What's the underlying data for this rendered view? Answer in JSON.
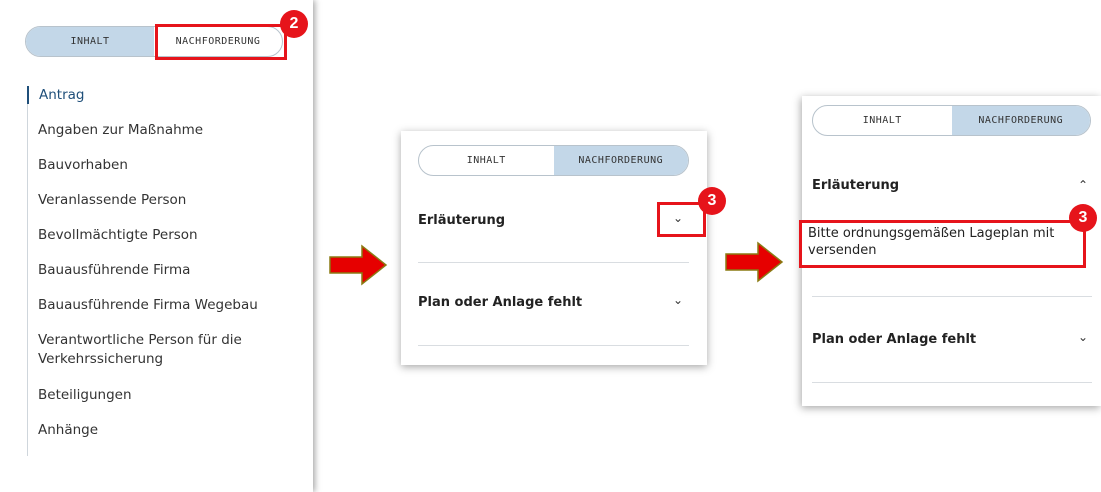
{
  "toggle": {
    "content_label": "INHALT",
    "requests_label": "NACHFORDERUNG"
  },
  "nav": {
    "items": [
      "Antrag",
      "Angaben zur Maßnahme",
      "Bauvorhaben",
      "Veranlassende Person",
      "Bevollmächtigte Person",
      "Bauausführende Firma",
      "Bauausführende Firma Wegebau",
      "Verantwortliche Person für die Verkehrssicherung",
      "Beteiligungen",
      "Anhänge"
    ],
    "active_index": 0
  },
  "accordion": {
    "section1_title": "Erläuterung",
    "section1_body": "Bitte ordnungsgemäßen Lageplan mit versenden",
    "section2_title": "Plan oder Anlage fehlt"
  },
  "annotations": {
    "badge_step2": "2",
    "badge_step3": "3"
  },
  "icons": {
    "collapsed": "chevron-down-icon",
    "expanded": "chevron-up-icon",
    "flow": "arrow-right-icon"
  },
  "colors": {
    "highlight": "#e6141b",
    "active_segment": "#c3d7e8",
    "active_nav": "#1f4f7a",
    "arrow_fill": "#e60000",
    "arrow_stroke": "#8a7a12"
  }
}
